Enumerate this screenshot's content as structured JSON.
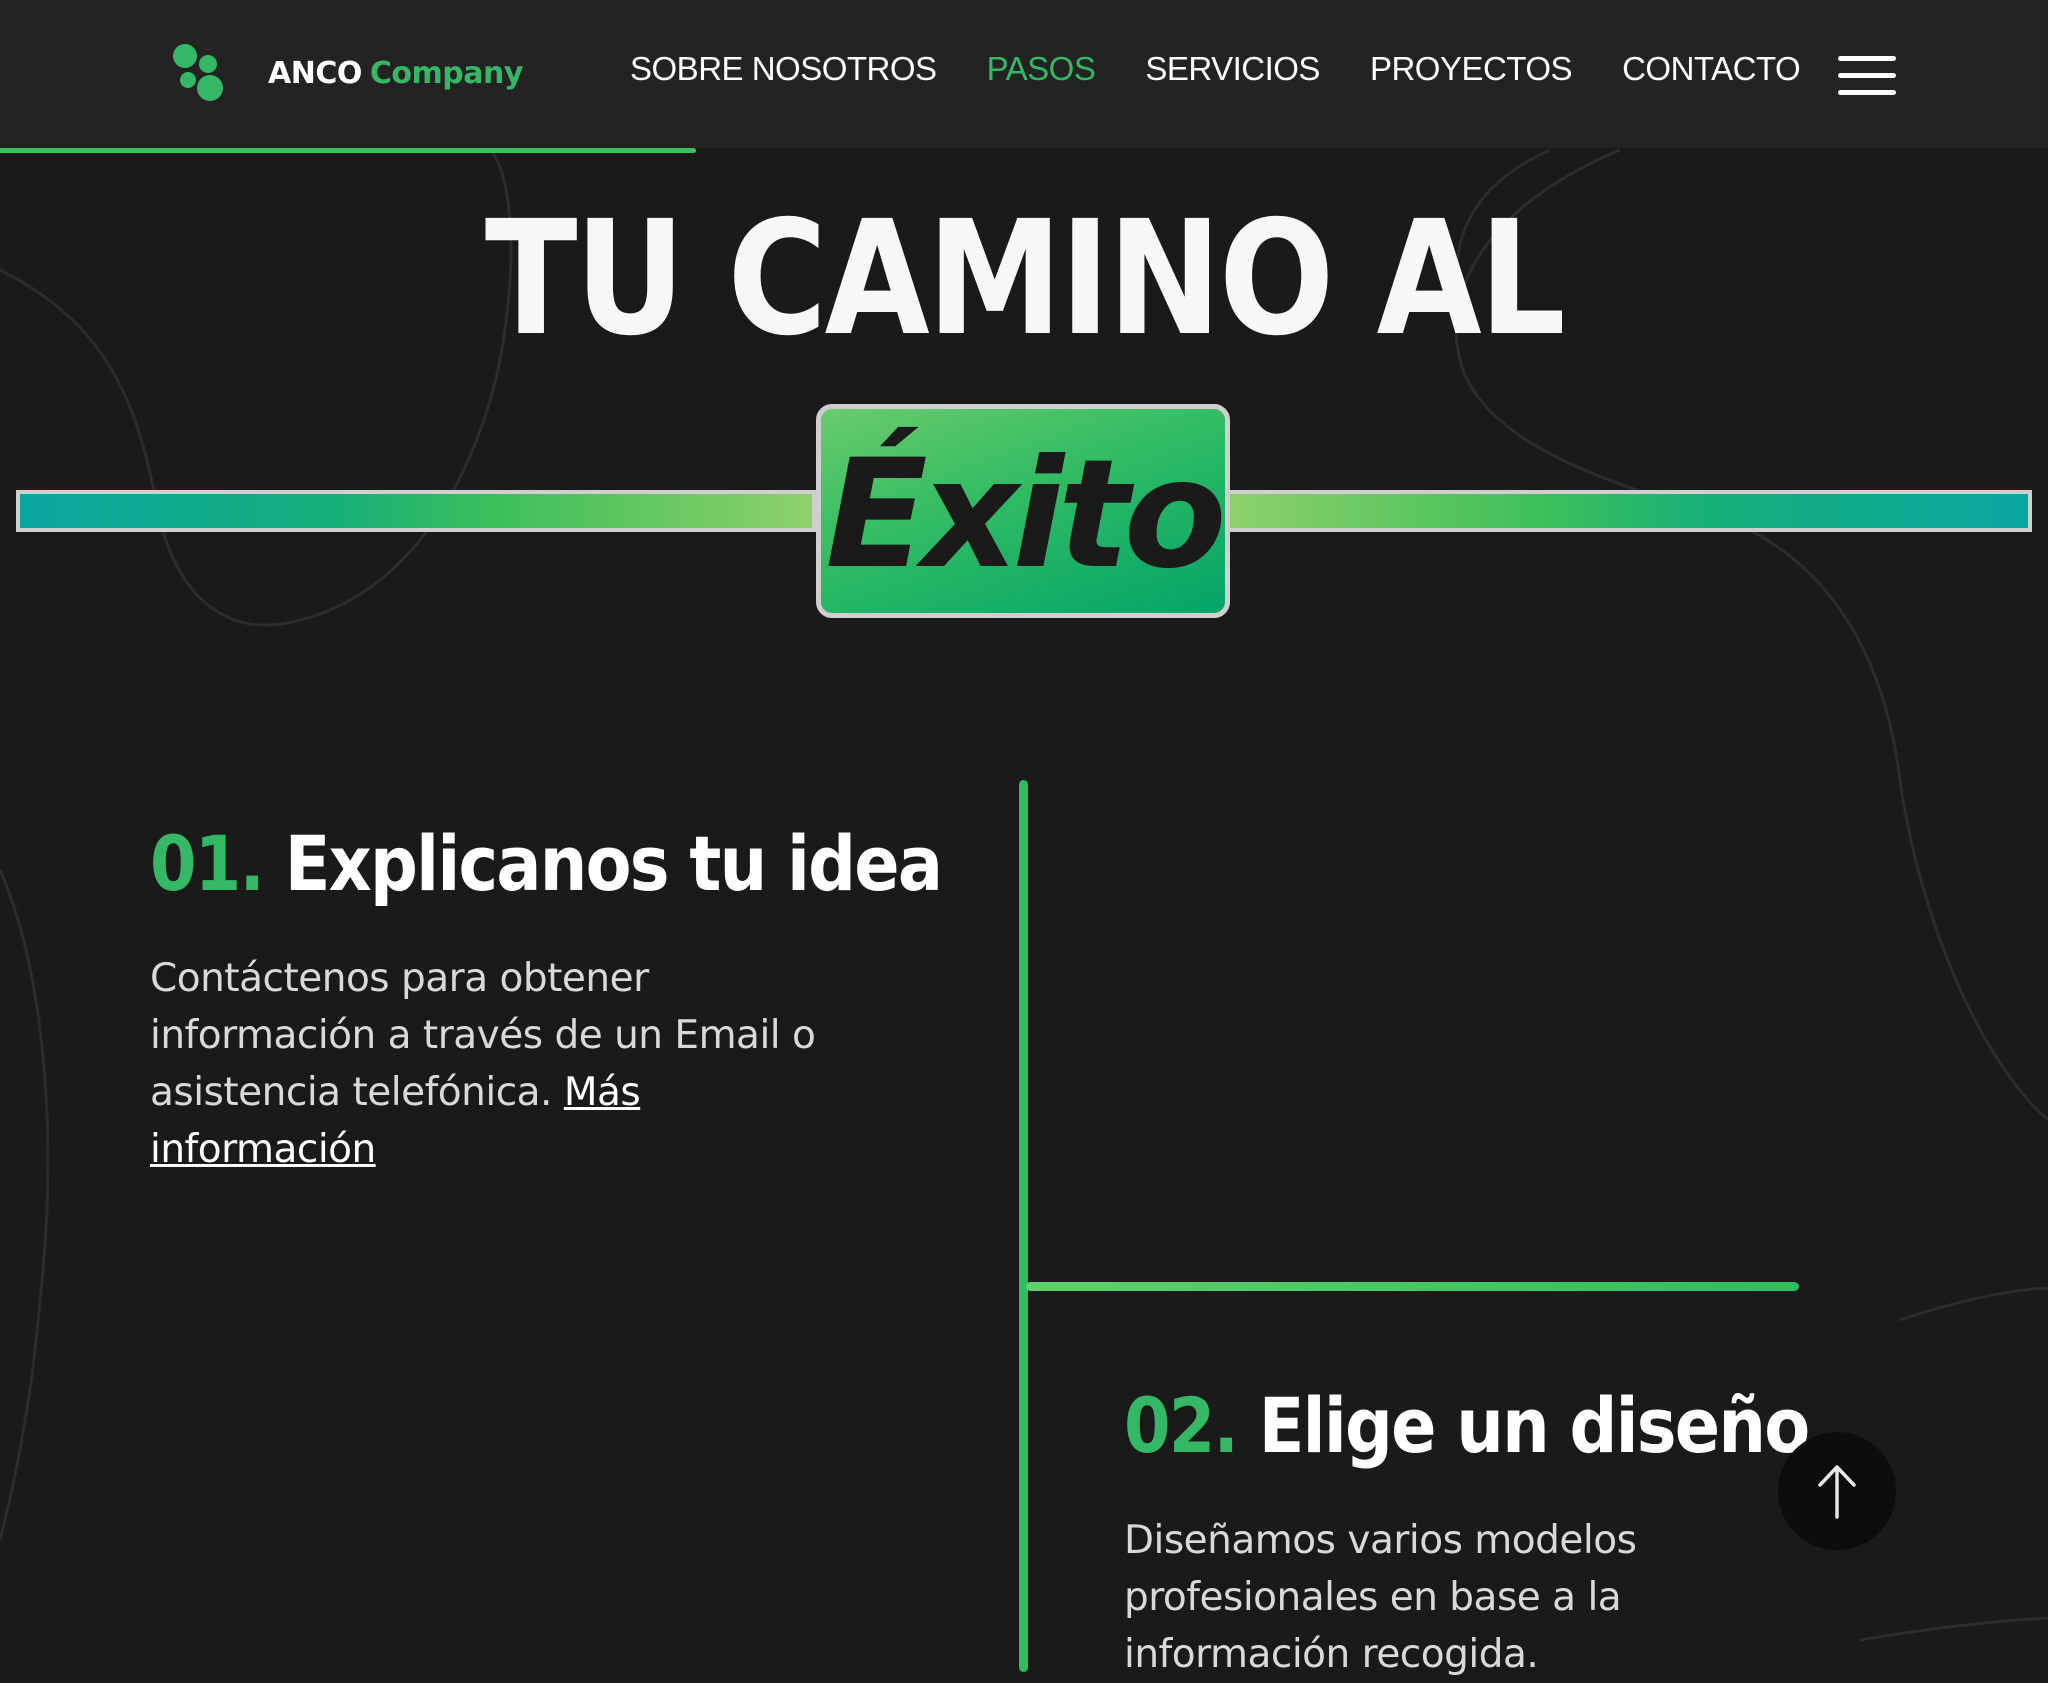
{
  "nav": {
    "logo": {
      "name": "ANCO",
      "accent": "Company"
    },
    "links": [
      {
        "label": "SOBRE NOSOTROS",
        "active": false
      },
      {
        "label": "PASOS",
        "active": true
      },
      {
        "label": "SERVICIOS",
        "active": false
      },
      {
        "label": "PROYECTOS",
        "active": false
      },
      {
        "label": "CONTACTO",
        "active": false
      }
    ],
    "menu_icon": "hamburger-icon",
    "scroll_progress": 0.34
  },
  "hero": {
    "title": "TU CAMINO AL",
    "highlight": "Éxito"
  },
  "steps": [
    {
      "number": "01.",
      "title": "Explicanos tu idea",
      "description": "Contáctenos para obtener información a través de un Email o asistencia telefónica. ",
      "link_label": "Más información"
    },
    {
      "number": "02.",
      "title": "Elige un diseño",
      "description": "Diseñamos varios modelos profesionales en base a la información recogida."
    }
  ],
  "scroll_top": {
    "icon": "arrow-up-icon"
  },
  "colors": {
    "accent": "#34b865",
    "background": "#1a1a1a",
    "navbar": "#232323",
    "timeline": "#2ebd60"
  }
}
